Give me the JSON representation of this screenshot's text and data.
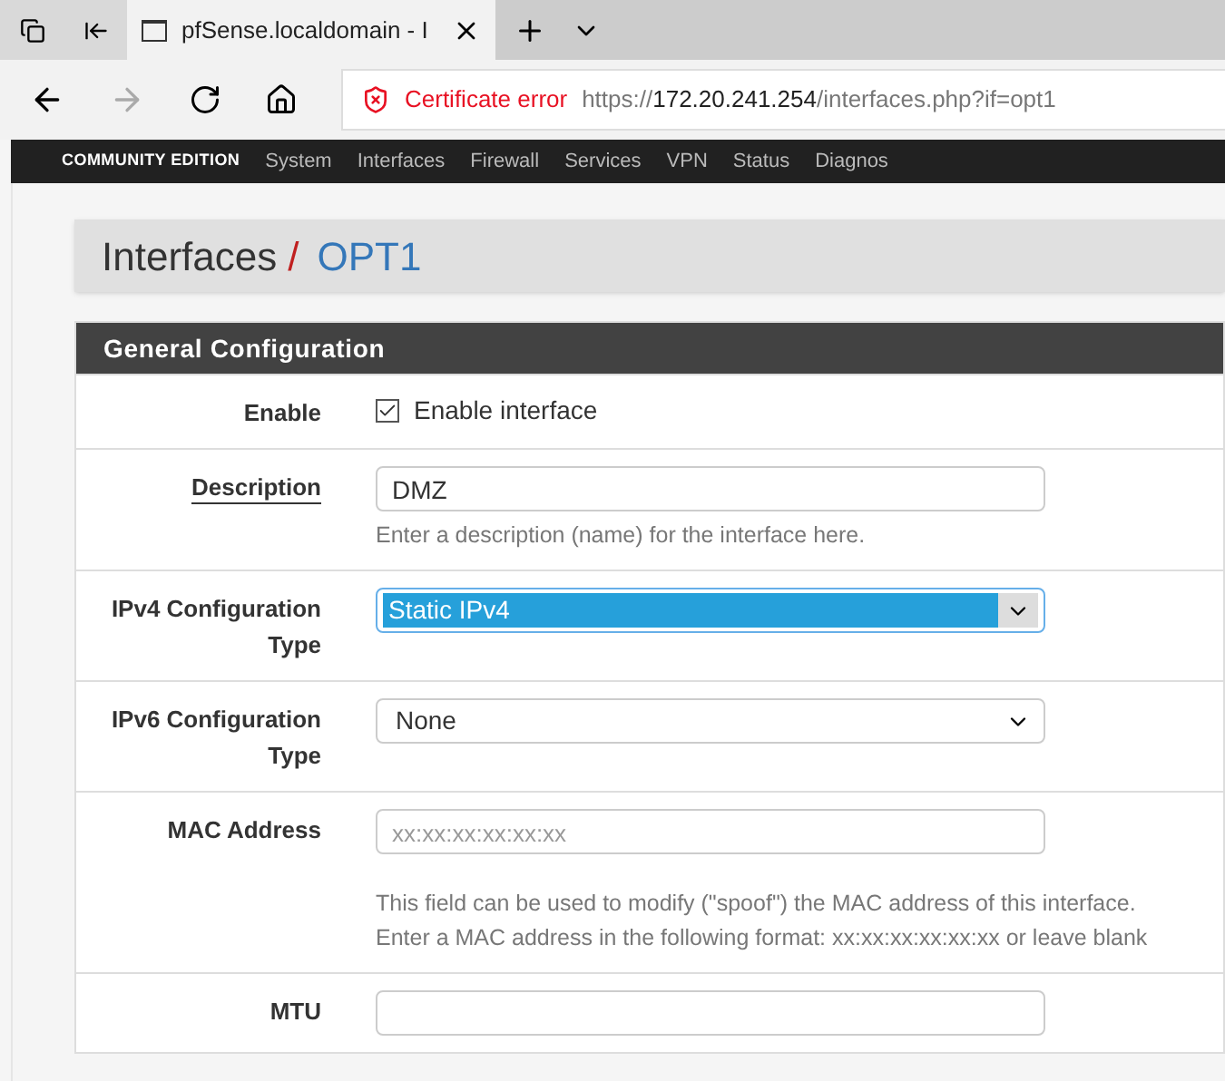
{
  "browser": {
    "tab_title": "pfSense.localdomain - I",
    "cert_error": "Certificate error",
    "url_scheme": "https://",
    "url_host": "172.20.241.254",
    "url_path": "/interfaces.php?if=opt1"
  },
  "navbar": {
    "logo_sub": "COMMUNITY EDITION",
    "menu": [
      "System",
      "Interfaces",
      "Firewall",
      "Services",
      "VPN",
      "Status",
      "Diagnos"
    ]
  },
  "breadcrumb": {
    "parent": "Interfaces",
    "separator": "/",
    "current": "OPT1"
  },
  "panel": {
    "title": "General Configuration"
  },
  "rows": [
    {
      "kind": "checkbox",
      "label": "Enable",
      "underlined": false,
      "checked": true,
      "text": "Enable interface"
    },
    {
      "kind": "text",
      "label": "Description",
      "underlined": true,
      "value": "DMZ",
      "help": [
        "Enter a description (name) for the interface here."
      ]
    },
    {
      "kind": "select",
      "label": "IPv4 Configuration Type",
      "underlined": false,
      "value": "Static IPv4",
      "focused": true
    },
    {
      "kind": "select",
      "label": "IPv6 Configuration Type",
      "underlined": false,
      "value": "None",
      "focused": false
    },
    {
      "kind": "text",
      "label": "MAC Address",
      "underlined": false,
      "placeholder": "xx:xx:xx:xx:xx:xx",
      "help": [
        "This field can be used to modify (\"spoof\") the MAC address of this interface.",
        "Enter a MAC address in the following format: xx:xx:xx:xx:xx:xx or leave blank"
      ]
    },
    {
      "kind": "text",
      "label": "MTU",
      "underlined": false
    }
  ]
}
